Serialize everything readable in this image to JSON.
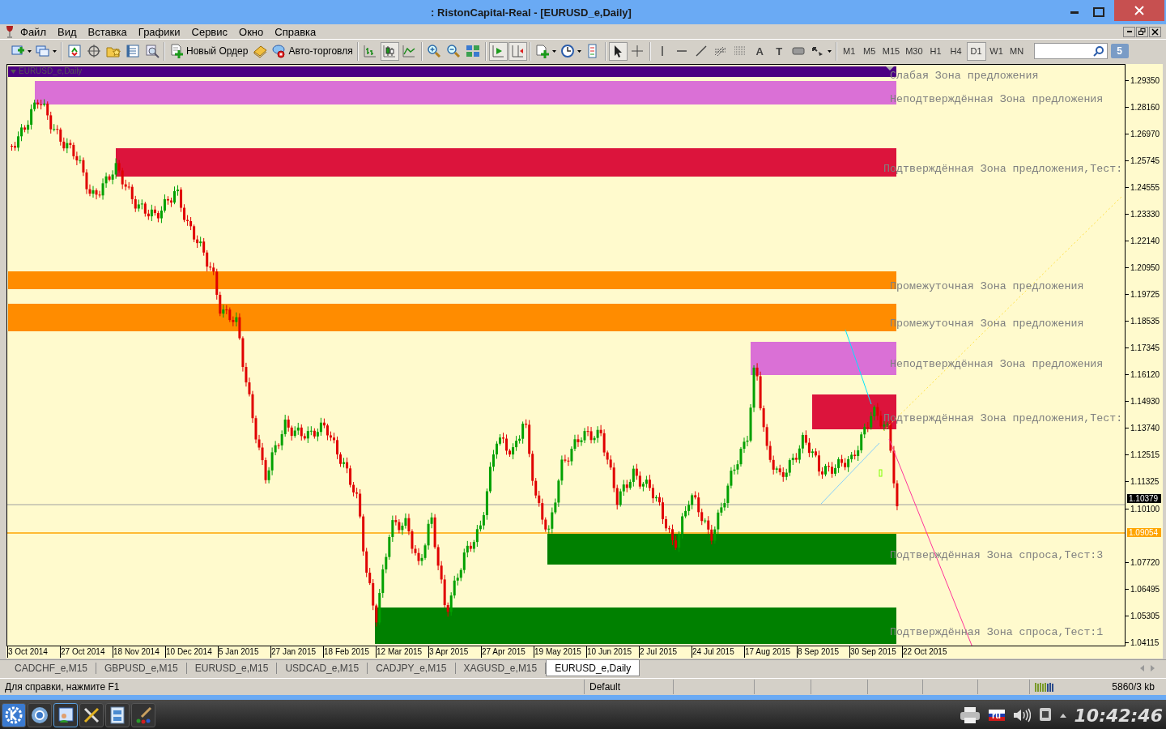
{
  "window": {
    "title": ": RistonCapital-Real - [EURUSD_e,Daily]"
  },
  "menu": [
    "Файл",
    "Вид",
    "Вставка",
    "Графики",
    "Сервис",
    "Окно",
    "Справка"
  ],
  "toolbar": {
    "groups": [
      [
        {
          "kind": "new-chart",
          "pressed": false
        },
        {
          "kind": "profiles",
          "pressed": false
        }
      ],
      [
        {
          "kind": "market-watch",
          "pressed": false
        },
        {
          "kind": "data-window",
          "pressed": false
        },
        {
          "kind": "navigator",
          "pressed": false
        },
        {
          "kind": "terminal",
          "pressed": false
        },
        {
          "kind": "tester",
          "pressed": false
        }
      ],
      [
        {
          "kind": "new-order",
          "label": "Новый Ордер",
          "pressed": false
        },
        {
          "kind": "metaeditor",
          "pressed": false
        },
        {
          "kind": "autotrading",
          "label": "Авто-торговля",
          "pressed": false
        }
      ],
      [
        {
          "kind": "bar-chart",
          "pressed": false
        },
        {
          "kind": "candle-chart",
          "pressed": true
        },
        {
          "kind": "line-chart",
          "pressed": false
        }
      ],
      [
        {
          "kind": "zoom-in",
          "pressed": false
        },
        {
          "kind": "zoom-out",
          "pressed": false
        },
        {
          "kind": "tile",
          "pressed": false
        }
      ],
      [
        {
          "kind": "autoscroll",
          "pressed": true
        },
        {
          "kind": "chart-shift",
          "pressed": true
        }
      ],
      [
        {
          "kind": "indicators",
          "pressed": false
        },
        {
          "kind": "periods",
          "pressed": false
        },
        {
          "kind": "templates",
          "pressed": false
        }
      ],
      [
        {
          "kind": "cursor",
          "pressed": true
        },
        {
          "kind": "crosshair",
          "pressed": false
        }
      ],
      [
        {
          "kind": "vline",
          "pressed": false
        },
        {
          "kind": "hline",
          "pressed": false
        },
        {
          "kind": "trendline",
          "pressed": false
        },
        {
          "kind": "fibo-e",
          "pressed": false
        },
        {
          "kind": "fibo-f",
          "pressed": false
        },
        {
          "kind": "text",
          "glyph": "A",
          "pressed": false
        },
        {
          "kind": "label",
          "glyph": "T",
          "pressed": false
        },
        {
          "kind": "rectangle",
          "pressed": false
        },
        {
          "kind": "arrows",
          "pressed": false
        }
      ]
    ],
    "timeframes": [
      {
        "label": "M1",
        "selected": false
      },
      {
        "label": "M5",
        "selected": false
      },
      {
        "label": "M15",
        "selected": false
      },
      {
        "label": "M30",
        "selected": false
      },
      {
        "label": "H1",
        "selected": false
      },
      {
        "label": "H4",
        "selected": false
      },
      {
        "label": "D1",
        "selected": true
      },
      {
        "label": "W1",
        "selected": false
      },
      {
        "label": "MN",
        "selected": false
      }
    ],
    "notifications": "5"
  },
  "chart": {
    "symbol_label": "EURUSD_e,Daily",
    "zones": [
      {
        "label": "Слабая Зона предложения",
        "color": "#4b0082"
      },
      {
        "label": "Неподтверждённая Зона предложения",
        "color": "#da70d6"
      },
      {
        "label": "Подтверждённая Зона предложения,Тест:",
        "color": "#dc143c"
      },
      {
        "label": "Промежуточная Зона предложения",
        "color": "#ff8c00"
      },
      {
        "label": "Промежуточная Зона предложения",
        "color": "#ff8c00"
      },
      {
        "label": "Неподтверждённая Зона предложения",
        "color": "#da70d6"
      },
      {
        "label": "Подтверждённая Зона предложения,Тест:",
        "color": "#dc143c"
      },
      {
        "label": "Подтверждённая Зона спроса,Тест:3",
        "color": "#008000"
      },
      {
        "label": "Подтверждённая Зона спроса,Тест:1",
        "color": "#008000"
      }
    ],
    "price_axis": [
      "1.29350",
      "1.28160",
      "1.26970",
      "1.25745",
      "1.24555",
      "1.23330",
      "1.22140",
      "1.20950",
      "1.19725",
      "1.18535",
      "1.17345",
      "1.16120",
      "1.14930",
      "1.13740",
      "1.12515",
      "1.11325",
      "1.10100",
      "1.07720",
      "1.06495",
      "1.05305",
      "1.04115"
    ],
    "current_price": "1.10379",
    "line_price": "1.09054",
    "dates": [
      "3 Oct 2014",
      "27 Oct 2014",
      "18 Nov 2014",
      "10 Dec 2014",
      "5 Jan 2015",
      "27 Jan 2015",
      "18 Feb 2015",
      "12 Mar 2015",
      "3 Apr 2015",
      "27 Apr 2015",
      "19 May 2015",
      "10 Jun 2015",
      "2 Jul 2015",
      "24 Jul 2015",
      "17 Aug 2015",
      "8 Sep 2015",
      "30 Sep 2015",
      "22 Oct 2015"
    ]
  },
  "tabs": [
    {
      "label": "CADCHF_e,M15",
      "selected": false
    },
    {
      "label": "GBPUSD_e,M15",
      "selected": false
    },
    {
      "label": "EURUSD_e,M15",
      "selected": false
    },
    {
      "label": "USDCAD_e,M15",
      "selected": false
    },
    {
      "label": "CADJPY_e,M15",
      "selected": false
    },
    {
      "label": "XAGUSD_e,M15",
      "selected": false
    },
    {
      "label": "EURUSD_e,Daily",
      "selected": true
    }
  ],
  "status_bar": {
    "help": "Для справки, нажмите F1",
    "profile": "Default",
    "traffic": "5860/3 kb"
  },
  "taskbar": {
    "flag_label": "ru",
    "clock": "10:42:46"
  }
}
